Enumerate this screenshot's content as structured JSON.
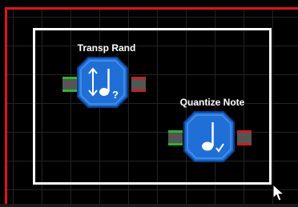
{
  "canvas": {
    "accent_color": "#e01515",
    "selection_color": "#ffffff"
  },
  "modules": [
    {
      "label": "Transp Rand",
      "icon": "note-transpose-random-icon",
      "body_color": "#1f6fd6"
    },
    {
      "label": "Quantize Note",
      "icon": "note-quantize-icon",
      "body_color": "#1f6fd6"
    }
  ],
  "ports": {
    "input_color": "#2db52d",
    "output_color": "#c42121"
  },
  "cursor": {
    "icon": "mouse-pointer-icon"
  }
}
